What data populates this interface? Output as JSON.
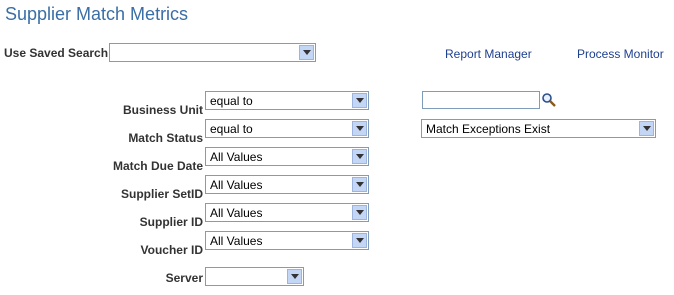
{
  "page": {
    "title": "Supplier Match Metrics"
  },
  "saved_search": {
    "label": "Use Saved Search",
    "value": ""
  },
  "links": {
    "report_manager": "Report Manager",
    "process_monitor": "Process Monitor"
  },
  "fields": {
    "business_unit": {
      "label": "Business Unit",
      "operator": "equal to",
      "value": ""
    },
    "match_status": {
      "label": "Match Status",
      "operator": "equal to",
      "value": "Match Exceptions Exist"
    },
    "match_due_date": {
      "label": "Match Due Date",
      "operator": "All Values"
    },
    "supplier_setid": {
      "label": "Supplier SetID",
      "operator": "All Values"
    },
    "supplier_id": {
      "label": "Supplier ID",
      "operator": "All Values"
    },
    "voucher_id": {
      "label": "Voucher ID",
      "operator": "All Values"
    },
    "server": {
      "label": "Server",
      "value": ""
    }
  },
  "icons": {
    "lookup": "magnifier-icon",
    "dropdown": "chevron-down-icon"
  },
  "colors": {
    "title": "#3a6ea5",
    "link": "#1f3f8f",
    "border": "#7f9db9",
    "arrow_bg": "#c3d6f5"
  }
}
